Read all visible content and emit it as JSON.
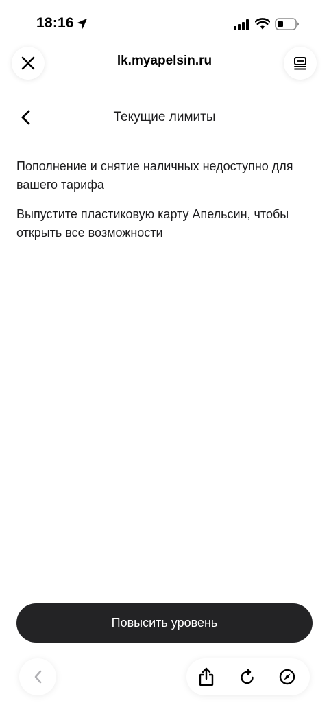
{
  "status_bar": {
    "time": "18:16",
    "icons": [
      "location-arrow-icon",
      "cellular-signal-icon",
      "wifi-icon",
      "battery-icon"
    ]
  },
  "browser": {
    "url": "lk.myapelsin.ru",
    "close_icon": "close-icon",
    "tabs_icon": "tabs-icon"
  },
  "page": {
    "back_icon": "chevron-left-icon",
    "title": "Текущие лимиты",
    "paragraphs": [
      "Пополнение и снятие наличных недоступно для вашего тарифа",
      "Выпустите пластиковую карту Апельсин, чтобы открыть все возможности"
    ],
    "cta_label": "Повысить уровень"
  },
  "toolbar": {
    "back_icon": "chevron-left-icon",
    "share_icon": "share-icon",
    "reload_icon": "reload-icon",
    "compass_icon": "compass-icon"
  },
  "colors": {
    "cta_background": "#232325",
    "cta_text": "#ffffff",
    "text": "#1c1c1e",
    "disabled_icon": "#b0b0b4"
  }
}
